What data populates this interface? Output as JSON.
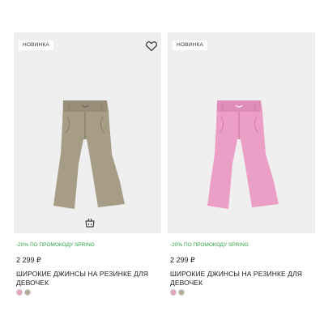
{
  "products": [
    {
      "badge": "НОВИНКА",
      "promo": "-20% ПО ПРОМОКОДУ SPRING",
      "price": "2 299 ₽",
      "title": "ШИРОКИЕ ДЖИНСЫ НА РЕЗИНКЕ ДЛЯ ДЕВОЧЕК",
      "jeans_color": "#a79c86",
      "jeans_shade": "#8c8270",
      "icons": [
        "heart-icon",
        "basket-icon"
      ],
      "swatches": [
        "#e2a6b4",
        "#b5ac98"
      ]
    },
    {
      "badge": "НОВИНКА",
      "promo": "-20% ПО ПРОМОКОДУ SPRING",
      "price": "2 299 ₽",
      "title": "ШИРОКИЕ ДЖИНСЫ НА РЕЗИНКЕ ДЛЯ ДЕВОЧЕК",
      "jeans_color": "#ec9fc6",
      "jeans_shade": "#d784b0",
      "swatches": [
        "#e2a6b4",
        "#b5ac98"
      ]
    }
  ],
  "colors": {
    "promo": "#2ea043",
    "photo_bg": "#efefef"
  }
}
